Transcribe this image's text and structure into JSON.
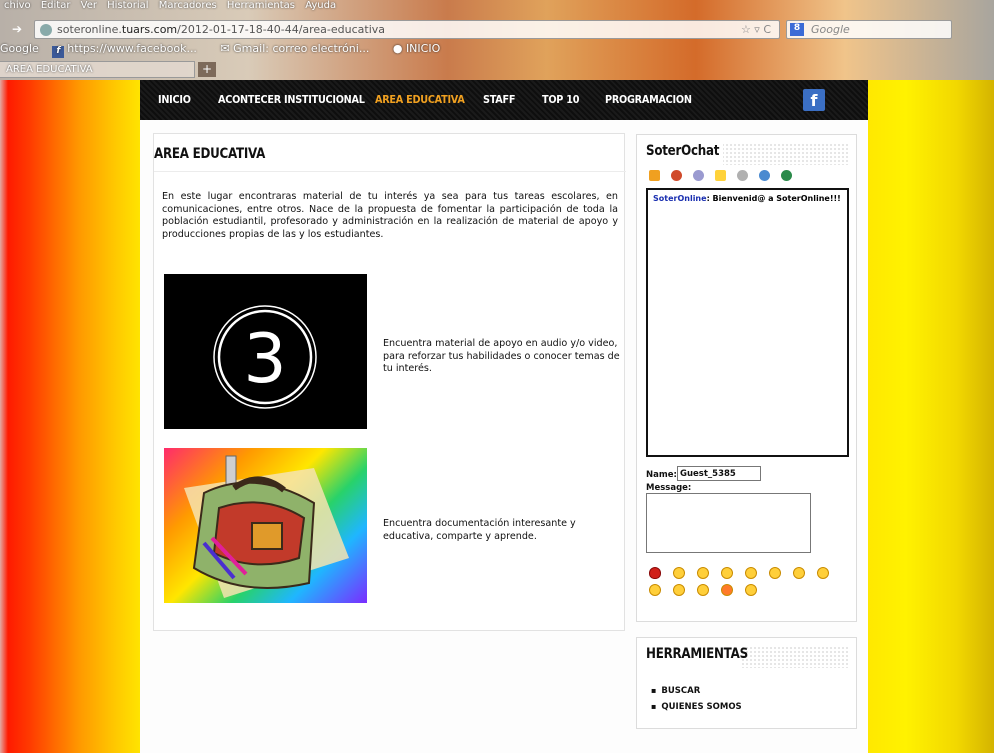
{
  "browser": {
    "menu": [
      "chivo",
      "Editar",
      "Ver",
      "Historial",
      "Marcadores",
      "Herramientas",
      "Ayuda"
    ],
    "url_prefix": "soteronline.",
    "url_domain": "tuars.com",
    "url_path": "/2012-01-17-18-40-44/area-educativa",
    "url_star": "☆ ▿ C",
    "search_placeholder": "Google",
    "bookmarks": [
      "Google",
      "https://www.facebook...",
      "Gmail: correo electróni...",
      "INICIO"
    ],
    "tab_title": "AREA EDUCATIVA",
    "new_tab": "+"
  },
  "nav": {
    "items": [
      "INICIO",
      "ACONTECER INSTITUCIONAL",
      "AREA EDUCATIVA",
      "STAFF",
      "TOP 10",
      "PROGRAMACION"
    ],
    "facebook": "f"
  },
  "main": {
    "title": "AREA EDUCATIVA",
    "intro": "En este lugar encontraras material de tu interés ya sea para tus tareas escolares, en comunicaciones, entre otros. Nace de la propuesta de fomentar la participación de toda la población estudiantil, profesorado y administración en la realización de material de apoyo y producciones propias de las y los estudiantes.",
    "video_number": "3",
    "video_text": "Encuentra material de apoyo en audio y/o video, para reforzar tus habilidades o conocer temas de tu interés.",
    "docs_text": "Encuentra documentación interesante y educativa, comparte y aprende."
  },
  "chat": {
    "title": "SoterOchat",
    "message_user": "SoterOnline",
    "message_text": ": Bienvenid@ a SoterOnline!!!",
    "name_label": "Name:",
    "name_value": "Guest_5385",
    "message_label": "Message:"
  },
  "tools": {
    "title": "HERRAMIENTAS",
    "items": [
      "BUSCAR",
      "QUIENES SOMOS"
    ]
  },
  "colors": {
    "nav_active": "#f0a020",
    "chat_user": "#1a2fb0",
    "facebook": "#3b5998"
  }
}
